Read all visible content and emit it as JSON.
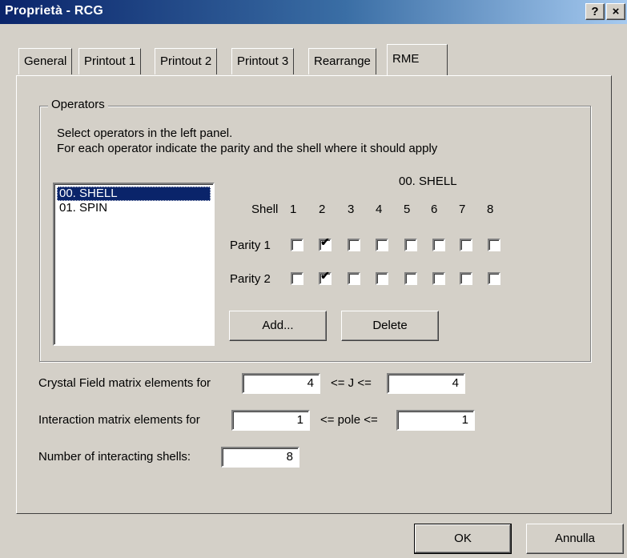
{
  "window": {
    "title": "Proprietà - RCG",
    "help_label": "?",
    "close_label": "×"
  },
  "tabs": [
    {
      "label": "General"
    },
    {
      "label": "Printout 1"
    },
    {
      "label": "Printout 2"
    },
    {
      "label": "Printout 3"
    },
    {
      "label": "Rearrange"
    },
    {
      "label": "RME",
      "active": true
    }
  ],
  "operators": {
    "group_label": "Operators",
    "instructions_line1": "Select operators in the left panel.",
    "instructions_line2": "For each operator indicate the parity and the shell where it should apply",
    "list": [
      "00. SHELL",
      "01. SPIN"
    ],
    "selected_index": 0,
    "selected_title": "00. SHELL",
    "shell_label": "Shell",
    "shell_numbers": [
      "1",
      "2",
      "3",
      "4",
      "5",
      "6",
      "7",
      "8"
    ],
    "parity1_label": "Parity 1",
    "parity2_label": "Parity 2",
    "parity1_checked": [
      false,
      true,
      false,
      false,
      false,
      false,
      false,
      false
    ],
    "parity2_checked": [
      false,
      true,
      false,
      false,
      false,
      false,
      false,
      false
    ],
    "add_label": "Add...",
    "delete_label": "Delete"
  },
  "crystal_field": {
    "label": "Crystal Field matrix elements for",
    "from": "4",
    "between_label": "<= J <=",
    "to": "4"
  },
  "interaction": {
    "label": "Interaction matrix elements for",
    "from": "1",
    "between_label": "<= pole <=",
    "to": "1"
  },
  "interacting_shells": {
    "label": "Number of interacting shells:",
    "value": "8"
  },
  "footer": {
    "ok_label": "OK",
    "cancel_label": "Annulla"
  }
}
